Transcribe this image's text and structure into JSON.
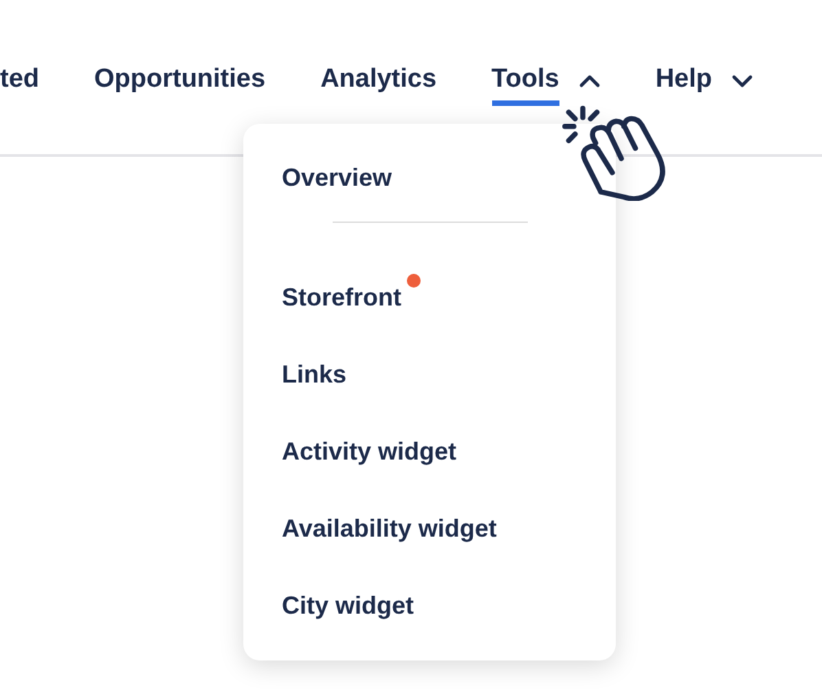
{
  "nav": [
    {
      "label": "ted",
      "kind": "link",
      "selected": false
    },
    {
      "label": "Opportunities",
      "kind": "link",
      "selected": false
    },
    {
      "label": "Analytics",
      "kind": "link",
      "selected": false
    },
    {
      "label": "Tools",
      "kind": "menu",
      "selected": true,
      "expanded": true
    },
    {
      "label": "Help",
      "kind": "menu",
      "selected": false,
      "expanded": false
    }
  ],
  "dropdown": {
    "groups": [
      [
        {
          "label": "Overview",
          "badge": false
        }
      ],
      [
        {
          "label": "Storefront",
          "badge": true
        },
        {
          "label": "Links",
          "badge": false
        },
        {
          "label": "Activity widget",
          "badge": false
        },
        {
          "label": "Availability widget",
          "badge": false
        },
        {
          "label": "City widget",
          "badge": false
        }
      ]
    ]
  }
}
